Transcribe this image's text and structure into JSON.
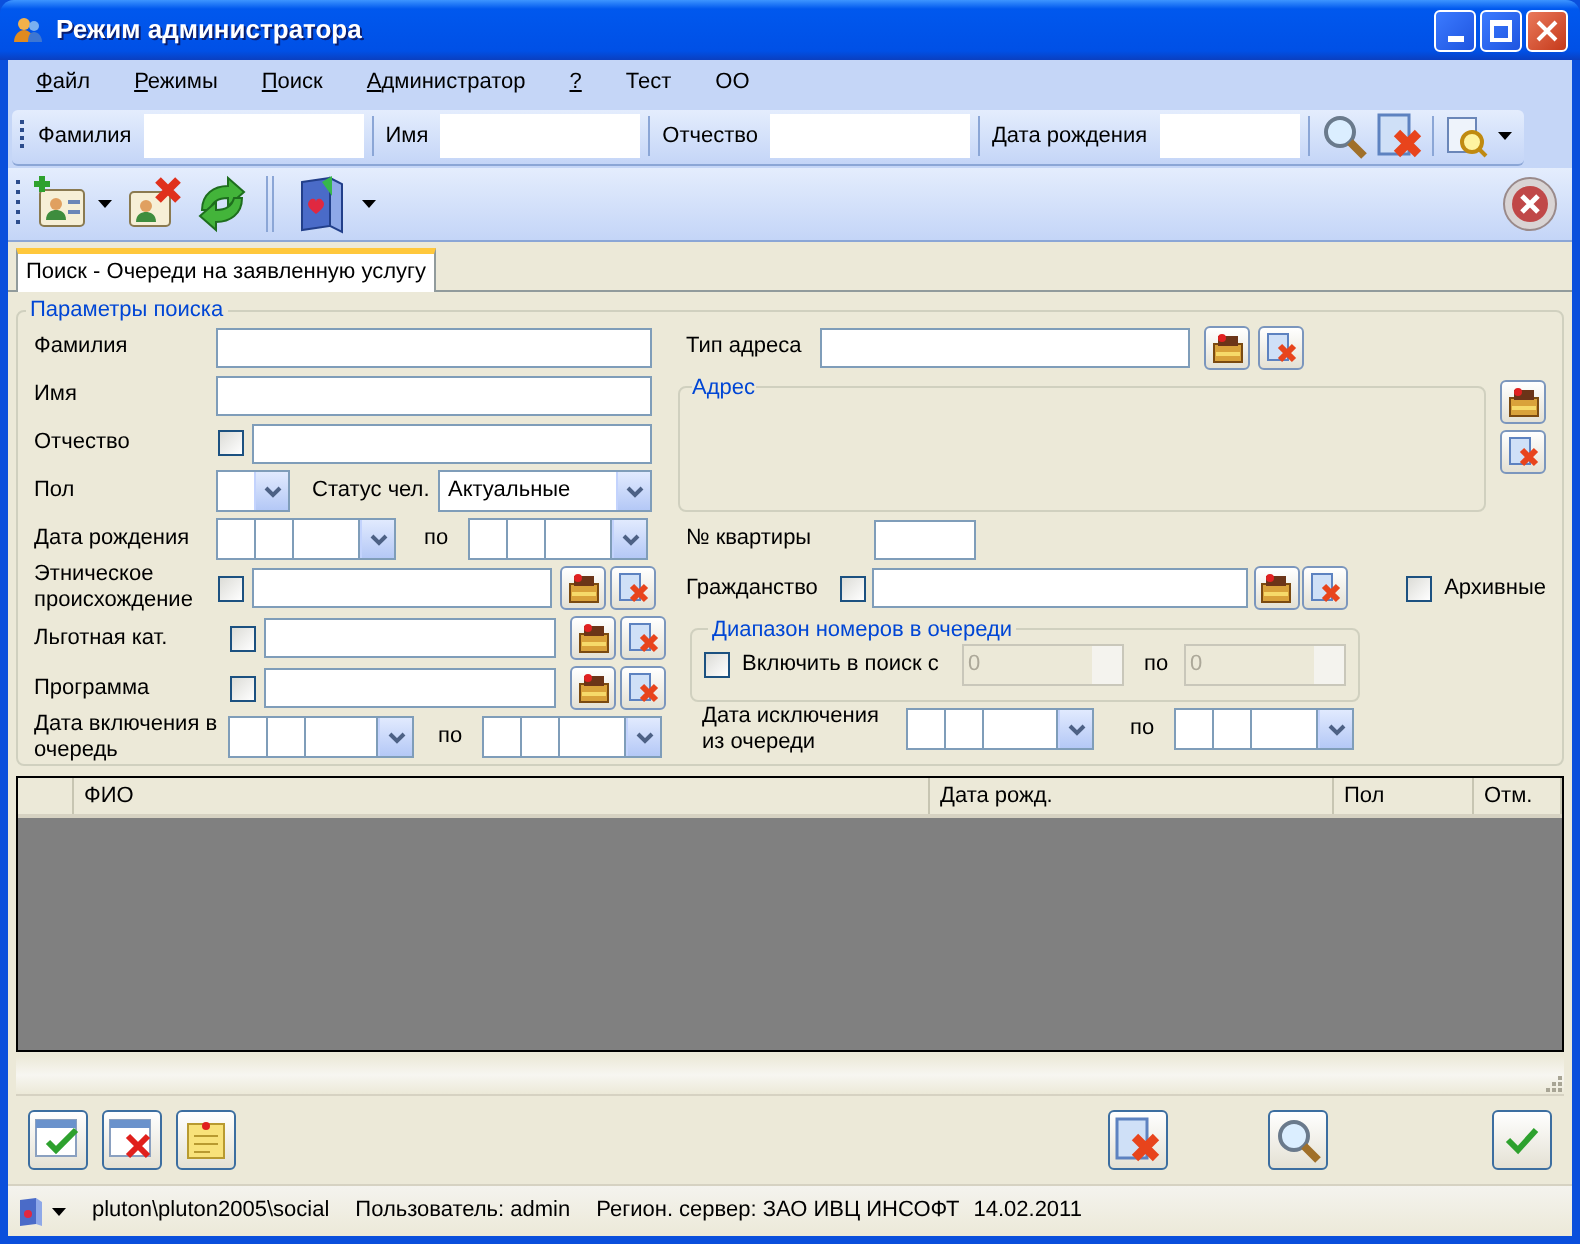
{
  "window": {
    "title": "Режим администратора"
  },
  "menu": [
    {
      "label": "Файл",
      "mnemonic": true
    },
    {
      "label": "Режимы",
      "mnemonic": true
    },
    {
      "label": "Поиск",
      "mnemonic": true
    },
    {
      "label": "Администратор",
      "mnemonic": true
    },
    {
      "label": "?",
      "mnemonic": true
    },
    {
      "label": "Тест",
      "mnemonic": false
    },
    {
      "label": "ОО",
      "mnemonic": false
    }
  ],
  "quick_search": [
    {
      "label": "Фамилия"
    },
    {
      "label": "Имя"
    },
    {
      "label": "Отчество"
    },
    {
      "label": "Дата рождения"
    }
  ],
  "tabs": [
    {
      "label": "Поиск - Очереди на заявленную услугу",
      "selected": true
    }
  ],
  "search_params": {
    "title": "Параметры поиска",
    "left_rows": [
      {
        "kind": "text",
        "label": "Фамилия"
      },
      {
        "kind": "text",
        "label": "Имя"
      },
      {
        "kind": "check_text",
        "label": "Отчество",
        "checked": false
      },
      {
        "kind": "gender_status",
        "label": "Пол",
        "status_label": "Статус чел.",
        "status_value": "Актуальные"
      },
      {
        "kind": "date_range",
        "label": "Дата рождения",
        "to_label": "по"
      },
      {
        "kind": "lookup",
        "label": "Этническое происхождение",
        "checked": false
      },
      {
        "kind": "lookup",
        "label": "Льготная кат.",
        "checked": false
      },
      {
        "kind": "lookup",
        "label": "Программа",
        "checked": false
      },
      {
        "kind": "date_range",
        "label": "Дата включения в очередь",
        "to_label": "по"
      }
    ],
    "address_type": {
      "label": "Тип адреса"
    },
    "address": {
      "title": "Адрес"
    },
    "apartment": {
      "label": "№ квартиры"
    },
    "citizenship": {
      "label": "Гражданство",
      "checked": false
    },
    "archived": {
      "label": "Архивные",
      "checked": false
    },
    "queue_range": {
      "title": "Диапазон номеров в очереди",
      "checkbox_label": "Включить в поиск с",
      "checked": false,
      "from": "0",
      "to_label": "по",
      "to": "0",
      "disabled": true
    },
    "exclusion_date": {
      "label": "Дата исключения из очереди",
      "to_label": "по"
    }
  },
  "table": {
    "columns": [
      "ФИО",
      "Дата рожд.",
      "Пол",
      "Отм."
    ]
  },
  "status_bar": [
    "pluton\\pluton2005\\social",
    "Пользователь: admin",
    "Регион. сервер: ЗАО ИВЦ ИНСОФТ",
    "14.02.2011"
  ]
}
